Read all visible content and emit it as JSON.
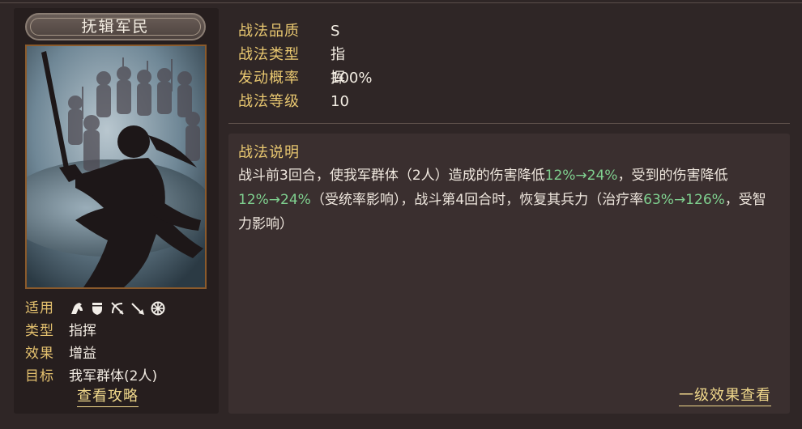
{
  "skill": {
    "name": "抚辑军民"
  },
  "left_info": {
    "applicable_label": "适用",
    "applicable_icons": [
      "cavalry-icon",
      "shield-icon",
      "bow-icon",
      "spear-icon",
      "siege-wheel-icon"
    ],
    "type_label": "类型",
    "type_value": "指挥",
    "effect_label": "效果",
    "effect_value": "增益",
    "target_label": "目标",
    "target_value": "我军群体(2人)",
    "guide_link": "查看攻略"
  },
  "stats": [
    {
      "label": "战法品质",
      "value": "S"
    },
    {
      "label": "战法类型",
      "value": "指挥"
    },
    {
      "label": "发动概率",
      "value": "100%"
    },
    {
      "label": "战法等级",
      "value": "10"
    }
  ],
  "description": {
    "title": "战法说明",
    "parts": [
      {
        "text": "战斗前3回合，使我军群体（2人）造成的伤害降低"
      },
      {
        "text": "12%→24%",
        "highlight": true
      },
      {
        "text": "，受到的伤害降低"
      },
      {
        "text": "12%→24%",
        "highlight": true
      },
      {
        "text": "（受统率影响），战斗第4回合时，恢复其兵力（治疗率"
      },
      {
        "text": "63%→126%",
        "highlight": true
      },
      {
        "text": "，受智力影响）"
      }
    ]
  },
  "effect_link": "一级效果查看",
  "colors": {
    "label_gold": "#e8c770",
    "highlight_green": "#7fd08f",
    "frame_orange": "#8b5a2b"
  }
}
